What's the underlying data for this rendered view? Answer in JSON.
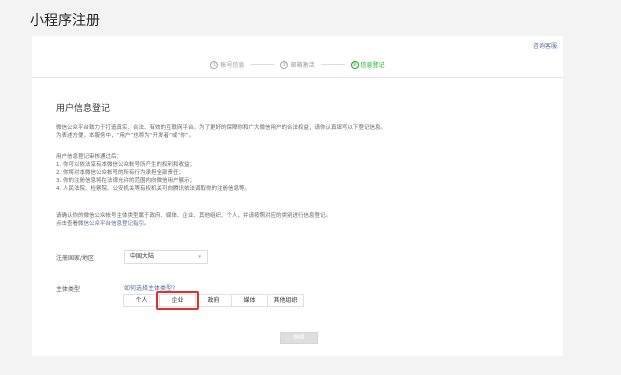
{
  "page_title": "小程序注册",
  "help_link": "咨询客服",
  "steps": [
    {
      "num": "①",
      "label": "帐号信息"
    },
    {
      "num": "②",
      "label": "邮箱激活"
    },
    {
      "num": "③",
      "label": "信息登记"
    }
  ],
  "section_title": "用户信息登记",
  "intro": [
    "微信公众平台致力于打造真实、合法、有效的互联网平台。为了更好的保障你和广大微信用户的合法权益，请你认真填写以下登记信息。",
    "为表述方便，本服务中，“用户”也称为“开发者”或“你”。"
  ],
  "rules": [
    "用户信息登记审核通过后：",
    "1. 你可以依法享有本微信公众帐号所产生的权利和收益；",
    "2. 你将对本微信公众帐号的所有行为承担全部责任；",
    "3. 你的注册信息将在法律允许的范围内向微信用户展示；",
    "4. 人民法院、检察院、公安机关等有权机关可向腾讯依法调取你的注册信息等。"
  ],
  "notice_line1": "请确认你的微信公众帐号主体类型属于政府、媒体、企业、其他组织、个人，并请按照对应的类别进行信息登记。",
  "notice_prefix": "点击查看",
  "notice_link": "微信公众平台信息登记指引",
  "notice_suffix": "。",
  "region_label": "注册国家/地区",
  "region_value": "中国大陆",
  "type_label": "主体类型",
  "type_help": "如何选择主体类型?",
  "types": [
    "个人",
    "企业",
    "政府",
    "媒体",
    "其他组织"
  ],
  "selected_type": "企业",
  "highlight_color": "#e0302c",
  "continue_label": "继续"
}
